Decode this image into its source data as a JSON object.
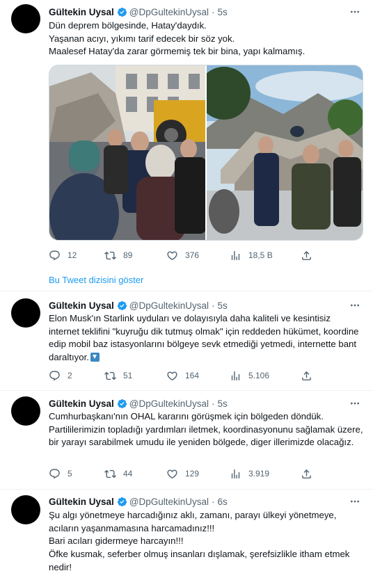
{
  "tweets": [
    {
      "name": "Gültekin Uysal",
      "handle": "@DpGultekinUysal",
      "time": "5s",
      "text": "Dün deprem bölgesinde, Hatay'daydık.\nYaşanan acıyı, yıkımı tarif edecek bir söz yok.\nMaalesef Hatay'da zarar görmemiş tek bir bina, yapı kalmamış.",
      "replies": "12",
      "retweets": "89",
      "likes": "376",
      "views": "18,5 B"
    },
    {
      "name": "Gültekin Uysal",
      "handle": "@DpGultekinUysal",
      "time": "5s",
      "text": "Elon Musk'ın Starlink uyduları ve dolayısıyla daha kaliteli ve kesintisiz internet teklifini \"kuyruğu dik tutmuş olmak\" için reddeden hükümet, koordine edip mobil baz istasyonlarını bölgeye sevk etmediği yetmedi, internette bant daraltıyor.",
      "replies": "2",
      "retweets": "51",
      "likes": "164",
      "views": "5.106"
    },
    {
      "name": "Gültekin Uysal",
      "handle": "@DpGultekinUysal",
      "time": "5s",
      "text": "Cumhurbaşkanı'nın OHAL kararını görüşmek için bölgeden döndük. Partililerimizin topladığı yardımları iletmek, koordinasyonunu sağlamak üzere, bir yarayı sarabilmek umudu ile yeniden bölgede, diger illerimizde olacağız.",
      "replies": "5",
      "retweets": "44",
      "likes": "129",
      "views": "3.919"
    },
    {
      "name": "Gültekin Uysal",
      "handle": "@DpGultekinUysal",
      "time": "6s",
      "text": "Şu algı yönetmeye harcadığınız aklı, zamanı, parayı ülkeyi yönetmeye, acıların yaşanmamasına harcamadınız!!!\nBari acıları gidermeye harcayın!!!\nÖfke kusmak, seferber olmuş insanları dışlamak, şerefsizlikle itham etmek nedir!"
    }
  ],
  "thread_link": "Bu Tweet dizisini göster",
  "colors": {
    "accent": "#1d9bf0",
    "muted": "#536471",
    "text": "#0f1419",
    "divider": "#eff3f4"
  },
  "icons": [
    "verified-badge-icon",
    "more-icon",
    "reply-icon",
    "retweet-icon",
    "like-icon",
    "views-icon",
    "share-icon",
    "arrow-down-emoji"
  ]
}
